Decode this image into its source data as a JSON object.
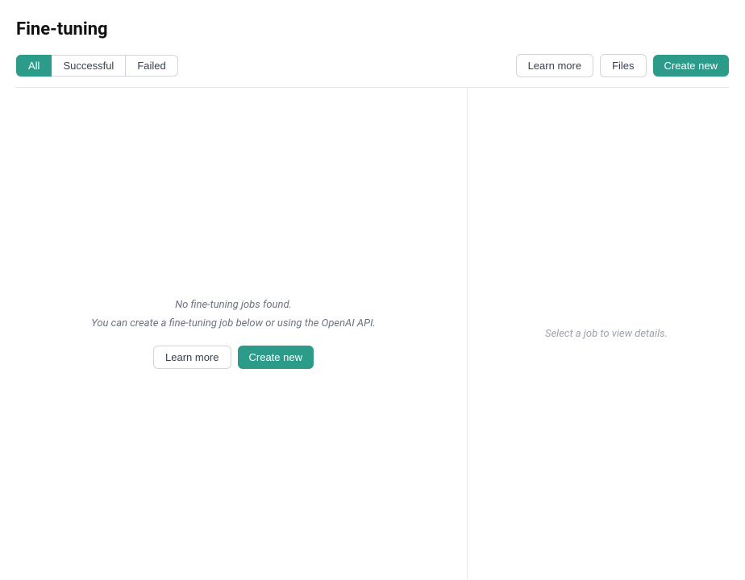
{
  "page": {
    "title": "Fine-tuning"
  },
  "tabs": {
    "all_label": "All",
    "successful_label": "Successful",
    "failed_label": "Failed",
    "active": "all"
  },
  "header_actions": {
    "learn_more_label": "Learn more",
    "files_label": "Files",
    "create_new_label": "Create new"
  },
  "empty_state": {
    "title": "No fine-tuning jobs found.",
    "subtitle": "You can create a fine-tuning job below or using the OpenAI API.",
    "learn_more_label": "Learn more",
    "create_new_label": "Create new"
  },
  "right_panel": {
    "select_job_text": "Select a job to view details."
  }
}
